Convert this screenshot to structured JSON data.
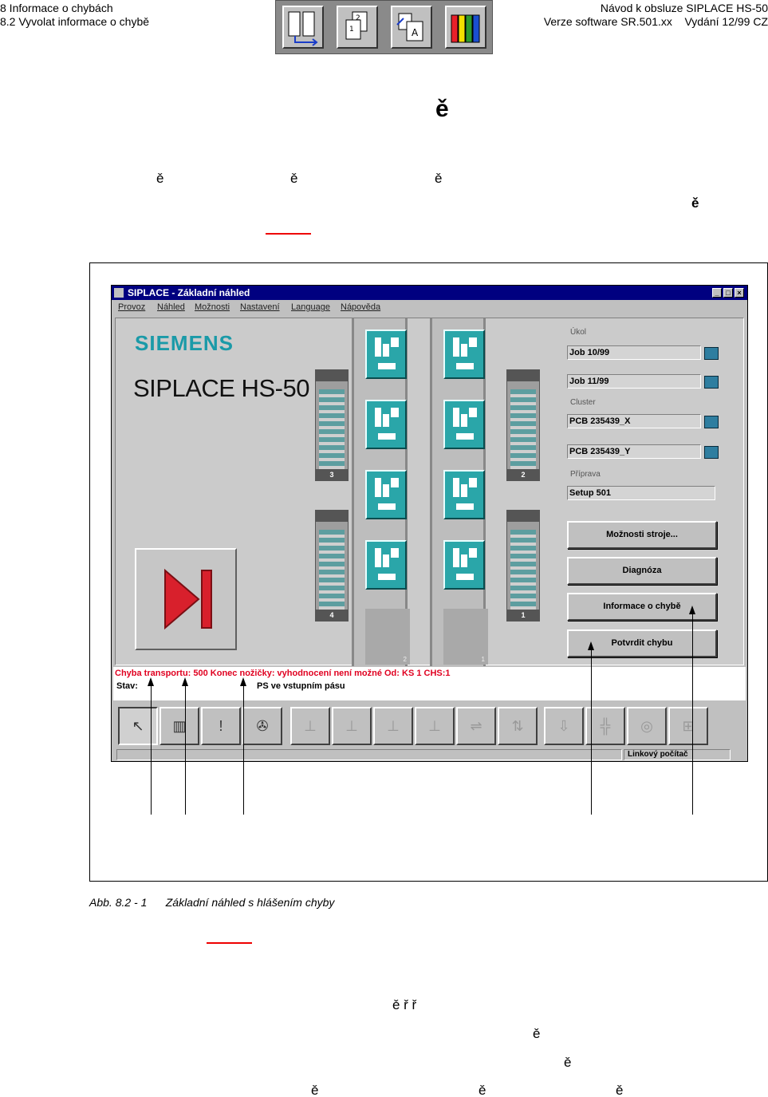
{
  "header": {
    "chapter": "8 Informace o chybách",
    "section": "8.2 Vyvolat informace o chybě",
    "manual": "Návod k obsluze SIPLACE HS-50",
    "version": "Verze software SR.501.xx",
    "edition": "Vydání 12/99 CZ"
  },
  "header_toolbar": {
    "icons": [
      "columns-icon",
      "pages-icon",
      "index-icon",
      "books-icon"
    ],
    "book_colors": [
      "#e8202a",
      "#f3e000",
      "#2c9a2c",
      "#1a4fd0"
    ]
  },
  "body_fragments": {
    "heading": "ě",
    "p1": [
      "ě",
      "ě",
      "ě"
    ],
    "p1_bold": "ě",
    "bottom_line1": "ě ř ř",
    "bottom_line2": "ě",
    "bottom_line3": "ě",
    "bottom_line4": [
      "ě",
      "ě",
      "ě"
    ]
  },
  "app": {
    "title": "SIPLACE - Základní náhled",
    "window_controls": [
      "_",
      "□",
      "×"
    ],
    "menu": [
      "Provoz",
      "Náhled",
      "Možnosti",
      "Nastavení",
      "Language",
      "Nápověda"
    ],
    "brand": "SIEMENS",
    "model": "SIPLACE HS-50",
    "feeder_numbers": [
      "3",
      "4",
      "2",
      "1"
    ],
    "gray_tile_numbers": [
      "2",
      "1"
    ],
    "right_panel": {
      "order_label": "Úkol",
      "order_fields": [
        "Job 10/99",
        "Job 11/99"
      ],
      "cluster_label": "Cluster",
      "cluster_fields": [
        "PCB 235439_X",
        "PCB 235439_Y"
      ],
      "setup_label": "Příprava",
      "setup_field": "Setup 501",
      "buttons": [
        "Možnosti stroje...",
        "Diagnóza",
        "Informace o chybě",
        "Potvrdit chybu"
      ]
    },
    "error_message": "Chyba transportu: 500  Konec nožičky: vyhodnocení není možné  Od: KS 1  CHS:1",
    "status_label": "Stav:",
    "status_value": "PS ve vstupním pásu",
    "status_bar_counter": "Linkový počítač",
    "toolbar_icons": [
      "pointer-icon",
      "feeder-list-icon",
      "exclamation-icon",
      "film-reel-icon",
      "station-1-icon",
      "station-2-icon",
      "station-3-icon",
      "station-4-icon",
      "conveyor-icon",
      "nozzle-icon",
      "head-icon",
      "placement-icon",
      "gauge-icon",
      "pcb-icon"
    ]
  },
  "caption": {
    "number": "Abb. 8.2 - 1",
    "text": "Základní náhled s hlášením chyby"
  },
  "colors": {
    "title_bar": "#000080",
    "siemens": "#1a9aa8",
    "error_text": "#e00020",
    "tile": "#2aa6a9",
    "play_arrow": "#d8202c",
    "reference_underline": "#e00000"
  }
}
